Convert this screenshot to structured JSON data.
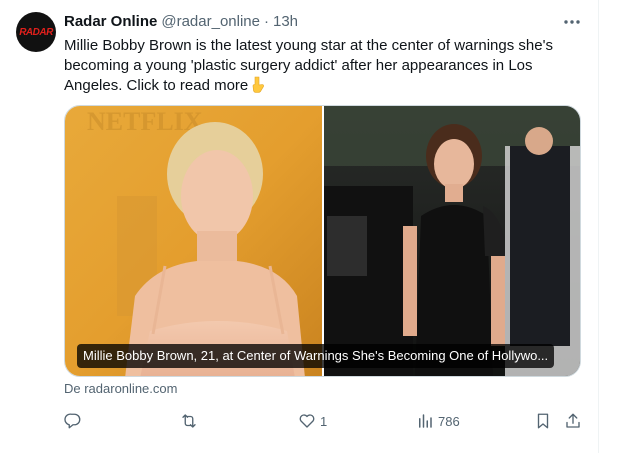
{
  "author": {
    "avatar_text": "RADAR",
    "name": "Radar Online",
    "handle": "@radar_online",
    "separator": "·",
    "time": "13h"
  },
  "tweet": {
    "text": "Millie Bobby Brown is the latest young star at the center of warnings she's becoming a young 'plastic surgery addict' after her appearances in Los Angeles. Click to read more",
    "emoji": "pointing-down-emoji"
  },
  "card": {
    "backdrop_text": "NETFLIX",
    "title": "Millie Bobby Brown, 21, at Center of Warnings She's Becoming One of Hollywo...",
    "source": "De radaronline.com"
  },
  "actions": {
    "reply": {
      "icon": "reply-icon",
      "count": ""
    },
    "retweet": {
      "icon": "retweet-icon",
      "count": ""
    },
    "like": {
      "icon": "heart-icon",
      "count": "1"
    },
    "views": {
      "icon": "views-icon",
      "count": "786"
    },
    "bookmark": {
      "icon": "bookmark-icon"
    },
    "share": {
      "icon": "share-icon"
    }
  },
  "colors": {
    "text": "#0f1419",
    "secondary": "#536471",
    "border": "#cfd9de",
    "brand_red": "#e0201c"
  }
}
